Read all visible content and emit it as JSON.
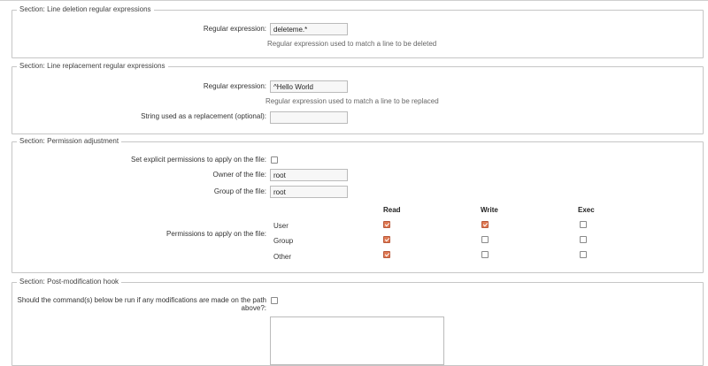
{
  "line_deletion": {
    "legend": "Section: Line deletion regular expressions",
    "regex_label": "Regular expression:",
    "regex_value": "deleteme.*",
    "regex_help": "Regular expression used to match a line to be deleted"
  },
  "line_replacement": {
    "legend": "Section: Line replacement regular expressions",
    "regex_label": "Regular expression:",
    "regex_value": "^Hello World",
    "regex_help": "Regular expression used to match a line to be replaced",
    "replacement_label": "String used as a replacement (optional):",
    "replacement_value": ""
  },
  "permission": {
    "legend": "Section: Permission adjustment",
    "explicit_label": "Set explicit permissions to apply on the file:",
    "explicit_checked": false,
    "owner_label": "Owner of the file:",
    "owner_value": "root",
    "group_label": "Group of the file:",
    "group_value": "root",
    "perms_label": "Permissions to apply on the file:",
    "columns": [
      "Read",
      "Write",
      "Exec"
    ],
    "rows": [
      {
        "label": "User",
        "read": true,
        "write": true,
        "exec": false
      },
      {
        "label": "Group",
        "read": true,
        "write": false,
        "exec": false
      },
      {
        "label": "Other",
        "read": true,
        "write": false,
        "exec": false
      }
    ],
    "checked_color": "#e07a54"
  },
  "hook": {
    "legend": "Section: Post-modification hook",
    "run_label_line1": "Should the command(s) below be run if any modifications are made on the path",
    "run_label_line2": "above?:",
    "run_checked": false,
    "command_value": ""
  }
}
